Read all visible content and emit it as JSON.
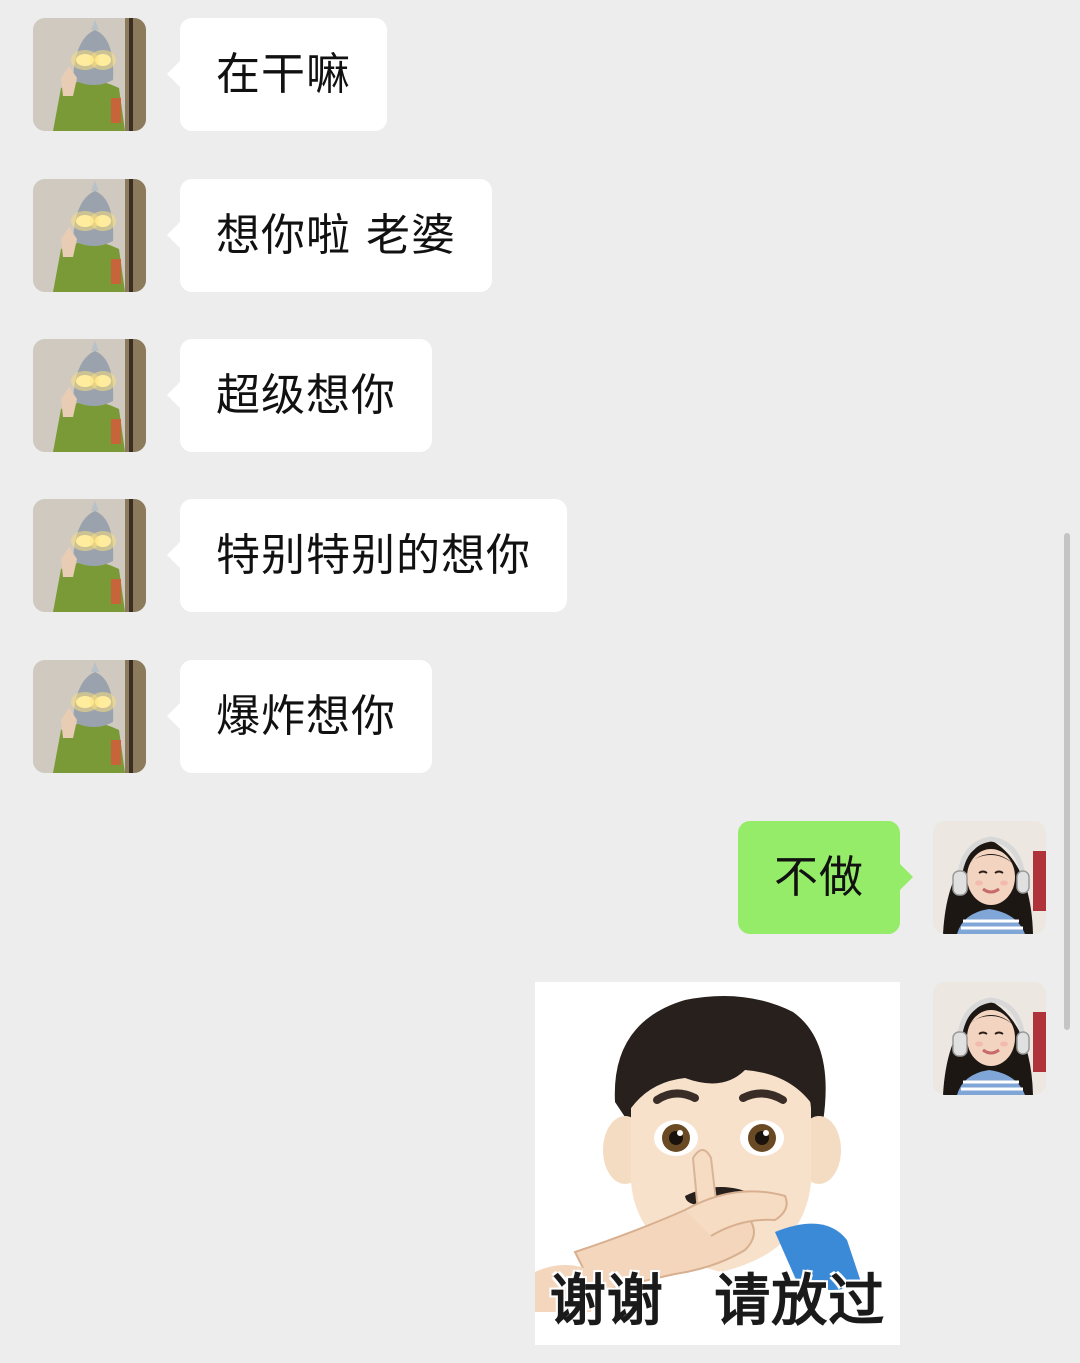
{
  "contact_avatar_icon": "masked-hero-avatar",
  "self_avatar_icon": "girl-with-headphones-avatar",
  "colors": {
    "background": "#ededed",
    "incoming_bubble": "#ffffff",
    "outgoing_bubble": "#95ec69"
  },
  "messages": [
    {
      "direction": "incoming",
      "text": "在干嘛"
    },
    {
      "direction": "incoming",
      "text": "想你啦 老婆"
    },
    {
      "direction": "incoming",
      "text": "超级想你"
    },
    {
      "direction": "incoming",
      "text": "特别特别的想你"
    },
    {
      "direction": "incoming",
      "text": "爆炸想你"
    },
    {
      "direction": "outgoing",
      "text": "不做"
    },
    {
      "direction": "outgoing",
      "type": "sticker",
      "sticker_icon": "man-crossing-fingers-emoji",
      "caption": "谢谢 请放过"
    }
  ]
}
